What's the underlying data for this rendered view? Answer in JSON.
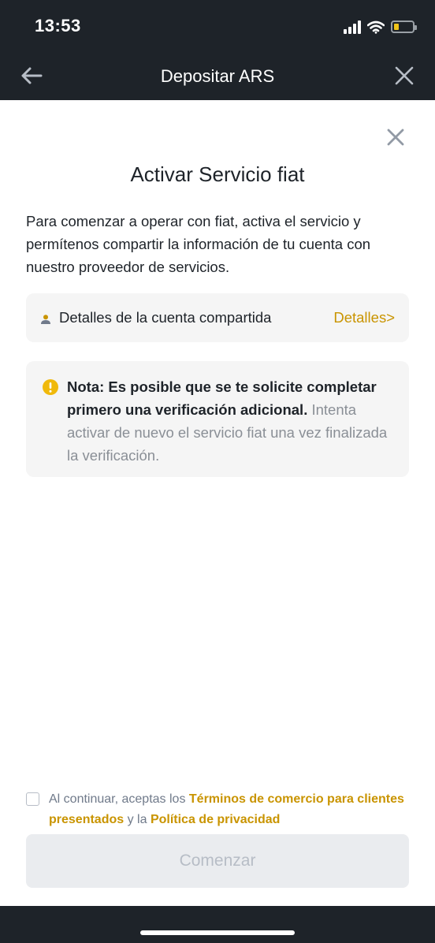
{
  "status_bar": {
    "time": "13:53",
    "icons": [
      "signal-icon",
      "wifi-icon",
      "battery-icon"
    ]
  },
  "nav": {
    "title": "Depositar ARS",
    "back_icon": "arrow-left-icon",
    "close_icon": "close-icon"
  },
  "modal": {
    "close_icon": "close-icon",
    "title": "Activar Servicio fiat",
    "intro": "Para comenzar a operar con fiat, activa el servicio y permítenos compartir la información de tu cuenta con nuestro proveedor de servicios.",
    "shared_account": {
      "icon": "person-icon",
      "label": "Detalles de la cuenta compartida",
      "link": "Detalles>"
    },
    "note": {
      "icon": "warning-icon",
      "bold_text": "Nota: Es posible que se te solicite completar primero una verificación adicional.",
      "text": " Intenta activar de nuevo el servicio fiat una vez finalizada la verificación."
    }
  },
  "terms": {
    "checked": false,
    "prefix": "Al continuar, aceptas los ",
    "link1": "Términos de comercio para clientes presentados",
    "middle": " y la ",
    "link2": "Política de privacidad"
  },
  "actions": {
    "start_label": "Comenzar"
  },
  "colors": {
    "dark_bar": "#1e2329",
    "accent": "#c99400",
    "card_bg": "#f5f5f5",
    "warning": "#f0b90b",
    "disabled_button": "#eaecef"
  }
}
